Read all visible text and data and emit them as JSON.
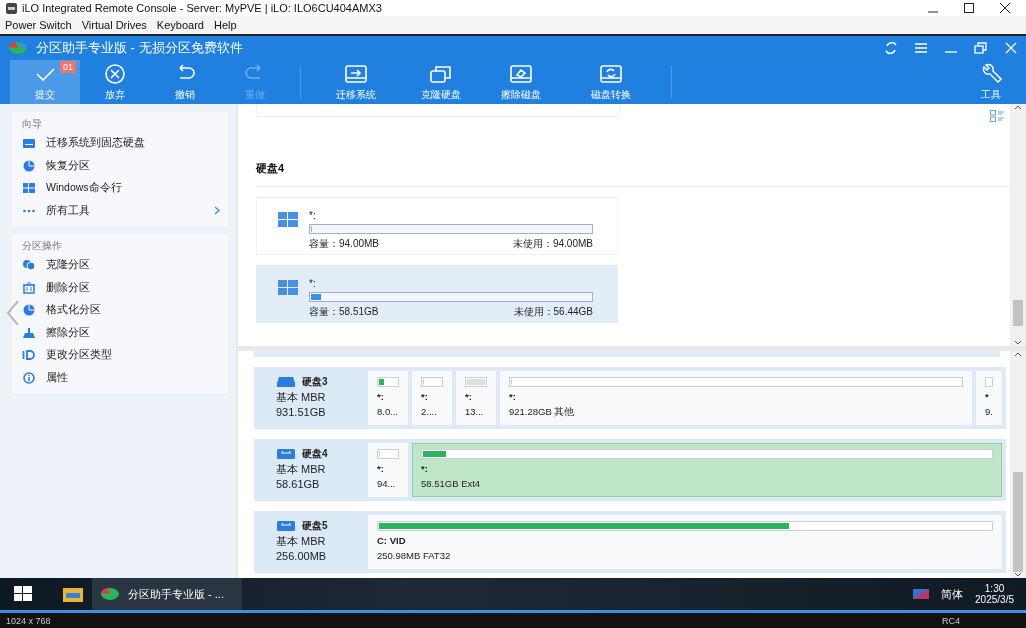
{
  "window": {
    "title": "iLO Integrated Remote Console - Server: MyPVE | iLO: ILO6CU404AMX3"
  },
  "menu": [
    "Power Switch",
    "Virtual Drives",
    "Keyboard",
    "Help"
  ],
  "app": {
    "title": "分区助手专业版 - 无损分区免费软件"
  },
  "toolbar": [
    {
      "label": "提交",
      "kind": "check",
      "badge": "01",
      "disabled": false,
      "selected": true
    },
    {
      "label": "放弃",
      "kind": "discard",
      "disabled": false,
      "selected": false
    },
    {
      "label": "撤销",
      "kind": "undo",
      "disabled": false,
      "selected": false
    },
    {
      "label": "重做",
      "kind": "redo",
      "disabled": true,
      "selected": false
    },
    {
      "label": "迁移系统",
      "kind": "migrate",
      "disabled": false,
      "selected": false
    },
    {
      "label": "克隆硬盘",
      "kind": "clone",
      "disabled": false,
      "selected": false
    },
    {
      "label": "擦除磁盘",
      "kind": "wipe",
      "disabled": false,
      "selected": false
    },
    {
      "label": "磁盘转换",
      "kind": "convert",
      "disabled": false,
      "selected": false
    }
  ],
  "tools_button": {
    "label": "工具"
  },
  "sidebar": [
    {
      "title": "向导",
      "items": [
        {
          "label": "迁移系统到固态硬盘",
          "kind": "drive",
          "has_submenu": false
        },
        {
          "label": "恢复分区",
          "kind": "pie",
          "has_submenu": false
        },
        {
          "label": "Windows命令行",
          "kind": "windows",
          "has_submenu": false
        },
        {
          "label": "所有工具",
          "kind": "dots",
          "has_submenu": true
        }
      ]
    },
    {
      "title": "分区操作",
      "items": [
        {
          "label": "克隆分区",
          "kind": "clone",
          "has_submenu": false
        },
        {
          "label": "删除分区",
          "kind": "trash",
          "has_submenu": false
        },
        {
          "label": "格式化分区",
          "kind": "pie",
          "has_submenu": false
        },
        {
          "label": "擦除分区",
          "kind": "broom",
          "has_submenu": false
        },
        {
          "label": "更改分区类型",
          "kind": "id",
          "has_submenu": false
        },
        {
          "label": "属性",
          "kind": "info",
          "has_submenu": false
        }
      ]
    }
  ],
  "disk_detail": {
    "title": "硬盘4",
    "partitions": [
      {
        "name": "*:",
        "level": 0,
        "capacity": "容量：94.00MB",
        "free": "未使用：94.00MB",
        "selected": false
      },
      {
        "name": "*:",
        "level": 0.035,
        "capacity": "容量：58.51GB",
        "free": "未使用：56.44GB",
        "selected": true
      }
    ]
  },
  "disks": [
    {
      "name": "硬盘3",
      "kind": "hdd",
      "type": "基本 MBR",
      "size": "931.51GB",
      "partitions": [
        {
          "kind": "narrow",
          "label": "*:",
          "info": "8.0...",
          "level": 0.3,
          "color": "#2db35c",
          "selected": false
        },
        {
          "kind": "narrow",
          "label": "*:",
          "info": "2....",
          "level": 0,
          "selected": false
        },
        {
          "kind": "narrow",
          "label": "*:",
          "info": "13...",
          "level": 1,
          "color": "#dcdfe2",
          "selected": false
        },
        {
          "kind": "wide",
          "label": "*:",
          "info": "921.28GB 其他",
          "level": 0,
          "selected": false
        },
        {
          "kind": "edge",
          "label": "*",
          "info": "9.",
          "selected": false
        }
      ]
    },
    {
      "name": "硬盘4",
      "kind": "usb",
      "type": "基本 MBR",
      "size": "58.61GB",
      "partitions": [
        {
          "kind": "narrow",
          "label": "*:",
          "info": "94...",
          "level": 0,
          "selected": false
        },
        {
          "kind": "wide",
          "label": "*:",
          "info": "58.51GB Ext4",
          "level": 0.04,
          "color": "#2db35c",
          "selected": true
        }
      ]
    },
    {
      "name": "硬盘5",
      "kind": "usb",
      "type": "基本 MBR",
      "size": "256.00MB",
      "partitions": [
        {
          "kind": "wide",
          "label": "C: VID",
          "info": "250.98MB FAT32",
          "level": 0.67,
          "color": "#2db35c",
          "selected": false
        }
      ]
    }
  ],
  "taskbar": {
    "app": "分区助手专业版 - ...",
    "language": "简体",
    "time": "1:30",
    "date": "2025/3/5"
  },
  "status_bar": {
    "resolution": "1024 x 768",
    "cipher": "RC4"
  }
}
